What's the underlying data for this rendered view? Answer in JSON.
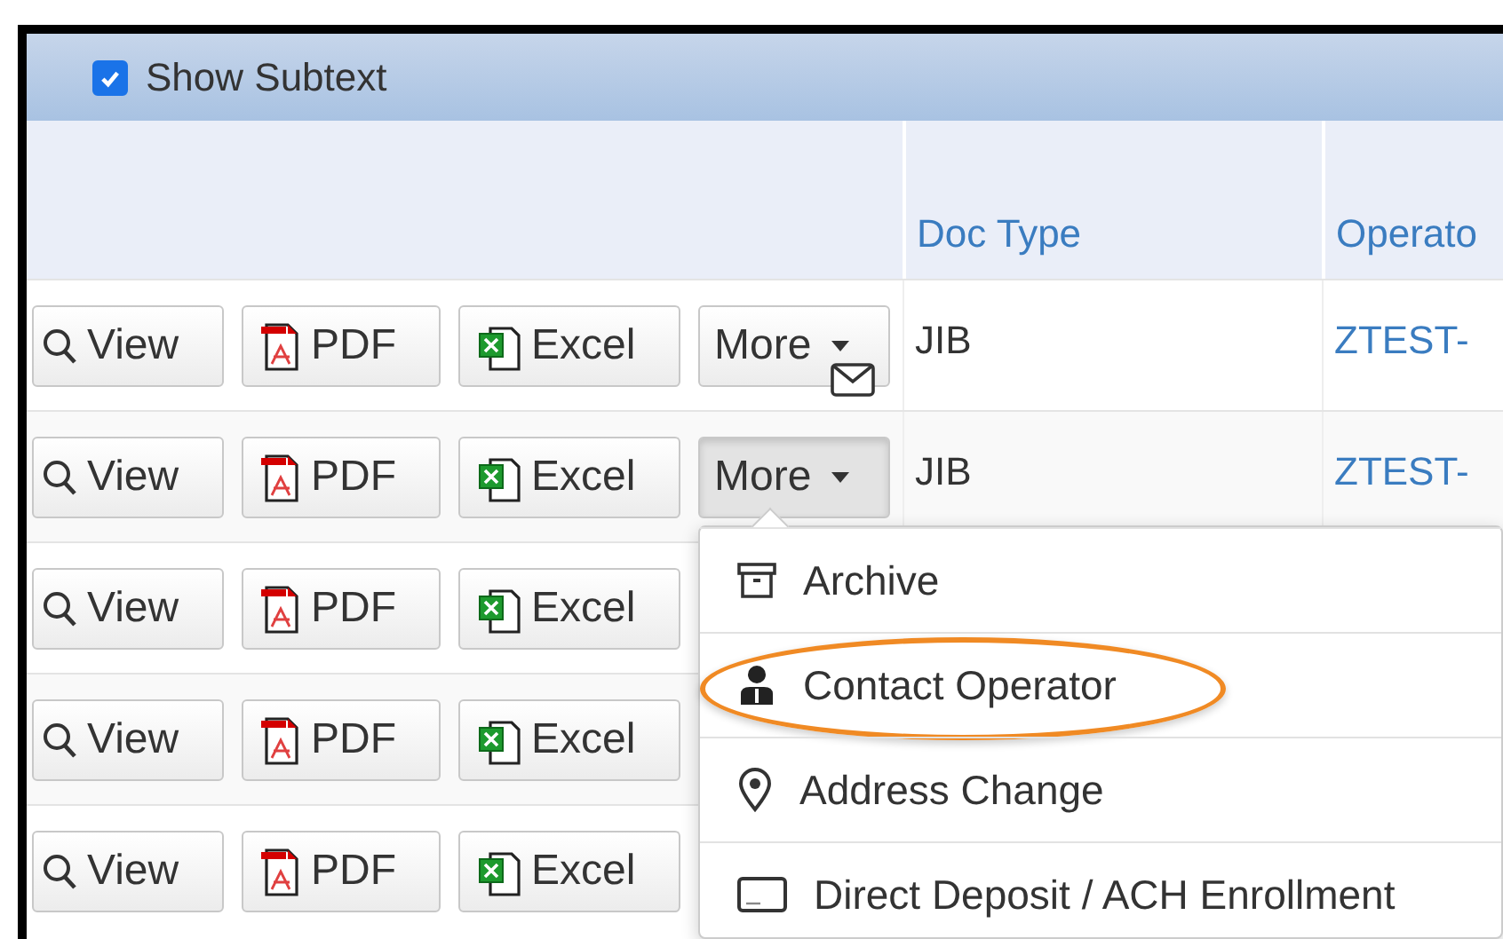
{
  "toolbar": {
    "show_subtext": {
      "label": "Show Subtext",
      "checked": true
    }
  },
  "table": {
    "columns": [
      "",
      "Doc Type",
      "Operato"
    ],
    "rows": [
      {
        "buttons": [
          "View",
          "PDF",
          "Excel"
        ],
        "more": {
          "label": "More",
          "selected": false,
          "mail_icon": true
        },
        "doc_type": "JIB",
        "operator": "ZTEST-"
      },
      {
        "buttons": [
          "View",
          "PDF",
          "Excel"
        ],
        "more": {
          "label": "More",
          "selected": true,
          "mail_icon": false
        },
        "doc_type": "JIB",
        "operator": "ZTEST-"
      },
      {
        "buttons": [
          "View",
          "PDF",
          "Excel"
        ]
      },
      {
        "buttons": [
          "View",
          "PDF",
          "Excel"
        ]
      },
      {
        "buttons": [
          "View",
          "PDF",
          "Excel"
        ]
      }
    ]
  },
  "more_menu": {
    "items": [
      {
        "kind": "archive",
        "label": "Archive",
        "highlighted": false
      },
      {
        "kind": "person",
        "label": "Contact Operator",
        "highlighted": true
      },
      {
        "kind": "pin",
        "label": "Address Change",
        "highlighted": false
      },
      {
        "kind": "card",
        "label": "Direct Deposit / ACH Enrollment",
        "highlighted": false
      }
    ]
  }
}
